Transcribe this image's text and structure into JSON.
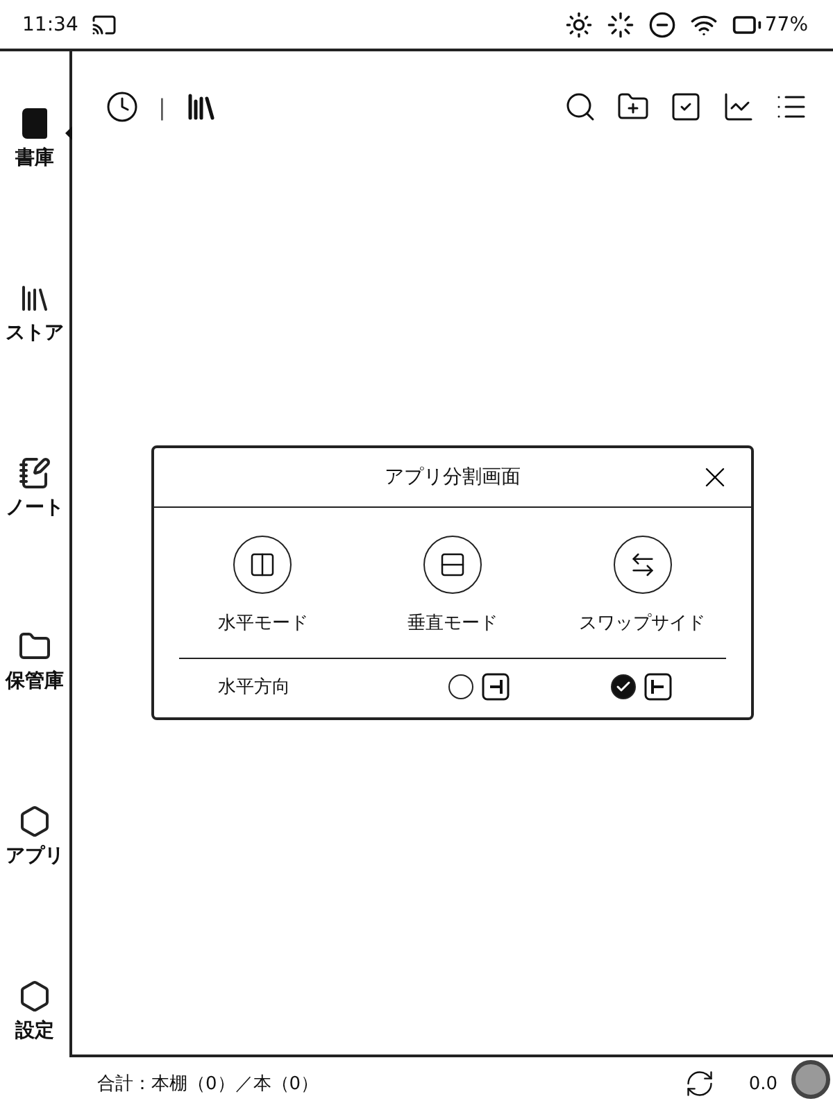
{
  "status_bar": {
    "time": "11:34",
    "battery": "77%"
  },
  "sidebar": {
    "items": [
      {
        "label": "書庫",
        "selected": true
      },
      {
        "label": "ストア",
        "selected": false
      },
      {
        "label": "ノート",
        "selected": false
      },
      {
        "label": "保管庫",
        "selected": false
      },
      {
        "label": "アプリ",
        "selected": false
      },
      {
        "label": "設定",
        "selected": false
      }
    ]
  },
  "toolbar": {
    "separator": "|"
  },
  "dialog": {
    "title": "アプリ分割画面",
    "modes": [
      {
        "label": "水平モード"
      },
      {
        "label": "垂直モード"
      },
      {
        "label": "スワップサイド"
      }
    ],
    "orientation": {
      "label": "水平方向",
      "options": [
        {
          "selected": false
        },
        {
          "selected": true
        }
      ]
    }
  },
  "footer": {
    "summary": "合計：本棚（0）／本（0）",
    "reading": "0.0"
  }
}
